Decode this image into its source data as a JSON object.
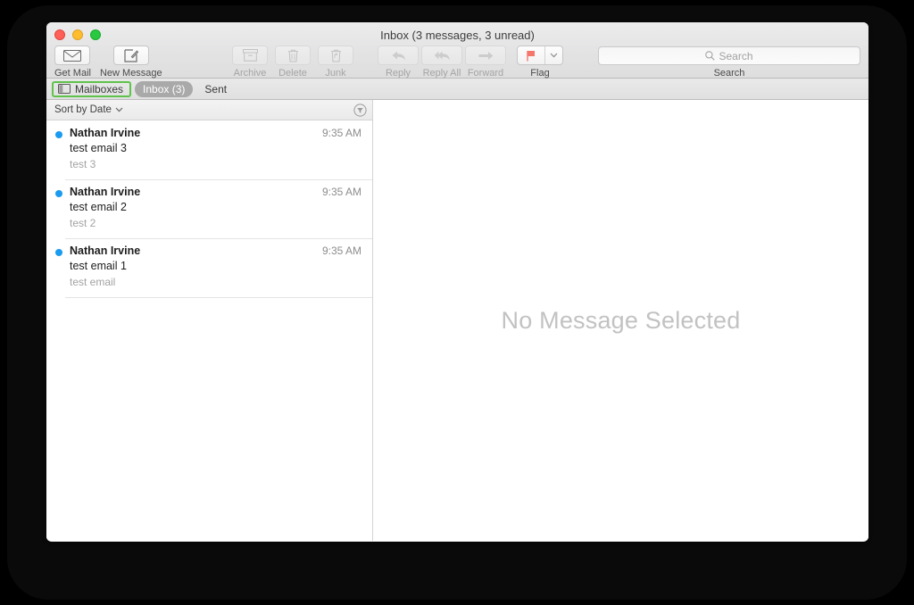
{
  "window": {
    "title": "Inbox (3 messages, 3 unread)",
    "traffic_lights": {
      "close_label": "close",
      "minimize_label": "minimize",
      "maximize_label": "maximize"
    }
  },
  "toolbar": {
    "items": [
      {
        "id": "get-mail",
        "label": "Get Mail",
        "icon": "envelope-icon",
        "enabled": true
      },
      {
        "id": "new-message",
        "label": "New Message",
        "icon": "compose-icon",
        "enabled": true
      },
      {
        "id": "archive",
        "label": "Archive",
        "icon": "archive-box-icon",
        "enabled": false
      },
      {
        "id": "delete",
        "label": "Delete",
        "icon": "trash-icon",
        "enabled": false
      },
      {
        "id": "junk",
        "label": "Junk",
        "icon": "junk-thumb-icon",
        "enabled": false
      },
      {
        "id": "reply",
        "label": "Reply",
        "icon": "reply-arrow-icon",
        "enabled": false
      },
      {
        "id": "reply-all",
        "label": "Reply All",
        "icon": "reply-all-icon",
        "enabled": false
      },
      {
        "id": "forward",
        "label": "Forward",
        "icon": "forward-arrow-icon",
        "enabled": false
      },
      {
        "id": "flag",
        "label": "Flag",
        "icon": "flag-icon",
        "enabled": true
      }
    ]
  },
  "search": {
    "placeholder": "Search",
    "value": "",
    "label": "Search",
    "icon": "search-icon"
  },
  "tabbar": {
    "mailboxes": {
      "label": "Mailboxes",
      "icon": "sidebar-toggle-icon",
      "highlighted": true,
      "highlight_color": "#5fc24b"
    },
    "tabs": [
      {
        "label": "Inbox (3)",
        "active": true
      },
      {
        "label": "Sent",
        "active": false
      }
    ]
  },
  "list_pane": {
    "sort": {
      "label": "Sort by Date",
      "chevron_icon": "chevron-down-icon"
    },
    "filter_icon": "filter-funnel-icon",
    "messages": [
      {
        "sender": "Nathan Irvine",
        "time": "9:35 AM",
        "subject": "test email 3",
        "preview": "test 3",
        "unread": true
      },
      {
        "sender": "Nathan Irvine",
        "time": "9:35 AM",
        "subject": "test email 2",
        "preview": "test 2",
        "unread": true
      },
      {
        "sender": "Nathan Irvine",
        "time": "9:35 AM",
        "subject": "test email 1",
        "preview": "test email",
        "unread": true
      }
    ]
  },
  "detail_pane": {
    "empty_state": "No Message Selected"
  },
  "colors": {
    "unread_dot": "#1a9bf0",
    "accent_highlight": "#5fc24b",
    "active_tab_bg": "#a9a9a9",
    "flag_red": "#f5766a",
    "empty_text": "#c2c2c2"
  }
}
